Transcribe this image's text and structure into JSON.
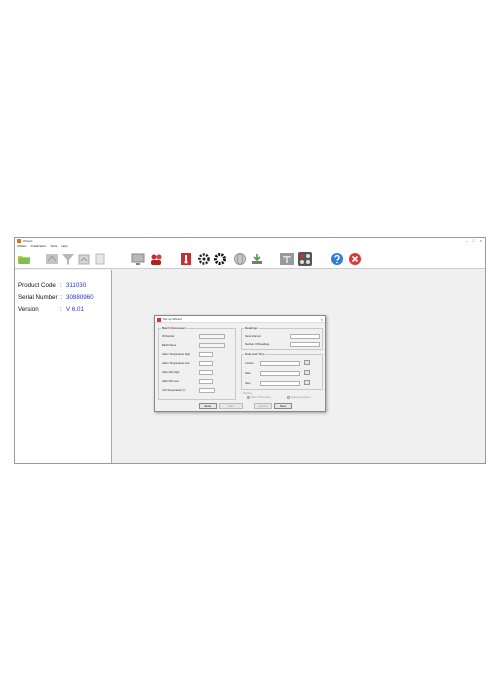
{
  "window": {
    "title": "Wizard",
    "controls": [
      "–",
      "□",
      "×"
    ]
  },
  "menu": [
    "Utilities",
    "Initialization",
    "Tools",
    "Help"
  ],
  "toolbar": {
    "icons": [
      "folder-icon",
      "gray-export-icon",
      "filter-icon",
      "gray-image-icon",
      "gray-document-icon",
      "monitor-icon",
      "users-icon",
      "thermometer-icon",
      "gear-icon",
      "settings-gear-icon",
      "globe-icon",
      "download-icon",
      "text-tool-icon",
      "grid-apps-icon",
      "help-icon",
      "close-icon"
    ]
  },
  "device": {
    "product_code_label": "Product Code",
    "product_code": "311030",
    "serial_label": "Serial Number",
    "serial": "30880960",
    "version_label": "Version",
    "version": "V 6.01",
    "separator": ":"
  },
  "dialog": {
    "title": "Set up Wizard",
    "close": "×",
    "batch_group": "Batch Parameters",
    "readings_group": "Readings",
    "datetime_group": "Date And Time",
    "fields": {
      "id_number": "ID Number",
      "batch_name": "Batch Name",
      "alarm_temp_high": "Alarm Temperature High",
      "alarm_temp_low": "Alarm Temperature Low",
      "alarm_rh_high": "Alarm RH High",
      "alarm_rh_low": "Alarm RH Low",
      "unit_temperature": "Unit Temperature (°)",
      "store_interval": "Store Interval",
      "number_of_readings": "Number Of Readings",
      "current": "Current",
      "start": "Start",
      "stop": "Stop"
    },
    "mode_label": "Starting",
    "radio_1": "Start Of Recording",
    "radio_2": "Delay Registration",
    "buttons": {
      "enter": "Enter",
      "start_a": "Start",
      "cancel": "Cancel",
      "save": "Save"
    }
  }
}
